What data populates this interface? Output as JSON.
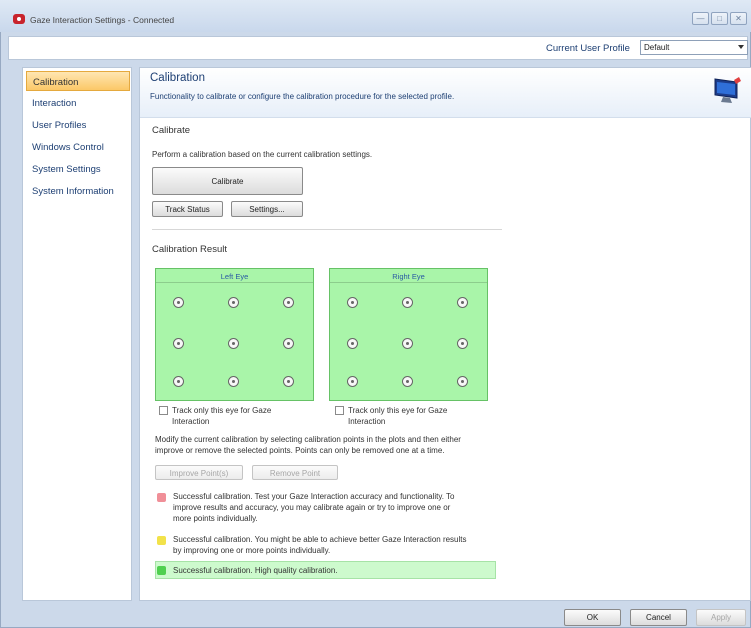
{
  "window": {
    "title": "Gaze Interaction Settings - Connected",
    "minimize": "—",
    "maximize": "□",
    "close": "✕"
  },
  "profile": {
    "label": "Current User Profile",
    "selected": "Default"
  },
  "sidebar": {
    "items": [
      {
        "label": "Calibration",
        "active": true
      },
      {
        "label": "Interaction",
        "active": false
      },
      {
        "label": "User Profiles",
        "active": false
      },
      {
        "label": "Windows Control",
        "active": false
      },
      {
        "label": "System Settings",
        "active": false
      },
      {
        "label": "System Information",
        "active": false
      }
    ]
  },
  "header": {
    "title": "Calibration",
    "description": "Functionality to calibrate or configure the calibration procedure for the selected profile.",
    "icon": "monitor-icon"
  },
  "calibrate": {
    "title": "Calibrate",
    "description": "Perform a calibration based on the current calibration settings.",
    "calibrate_button": "Calibrate",
    "track_status_button": "Track Status",
    "settings_button": "Settings..."
  },
  "result": {
    "title": "Calibration Result",
    "left_eye": {
      "title": "Left Eye",
      "checkbox_label_1": "Track only this eye for Gaze",
      "checkbox_label_2": "Interaction"
    },
    "right_eye": {
      "title": "Right Eye",
      "checkbox_label_1": "Track only this eye for Gaze",
      "checkbox_label_2": "Interaction"
    },
    "modify_line_1": "Modify the current calibration by selecting calibration points in the plots and then either",
    "modify_line_2": "improve or remove the selected points. Points can only be removed one at a time.",
    "improve_button": "Improve Point(s)",
    "remove_button": "Remove Point"
  },
  "legend": {
    "red": {
      "color": "#f08f98",
      "line_1": "Successful calibration. Test your Gaze Interaction accuracy and functionality. To",
      "line_2": "improve results and accuracy, you may calibrate again or try to improve one or",
      "line_3": "more points individually."
    },
    "yellow": {
      "color": "#f2e24a",
      "line_1": "Successful calibration. You might be able to achieve better Gaze Interaction results",
      "line_2": "by improving one or more points individually."
    },
    "green": {
      "color": "#4fd04f",
      "line_1": "Successful calibration. High quality calibration."
    }
  },
  "footer": {
    "ok": "OK",
    "cancel": "Cancel",
    "apply": "Apply"
  }
}
